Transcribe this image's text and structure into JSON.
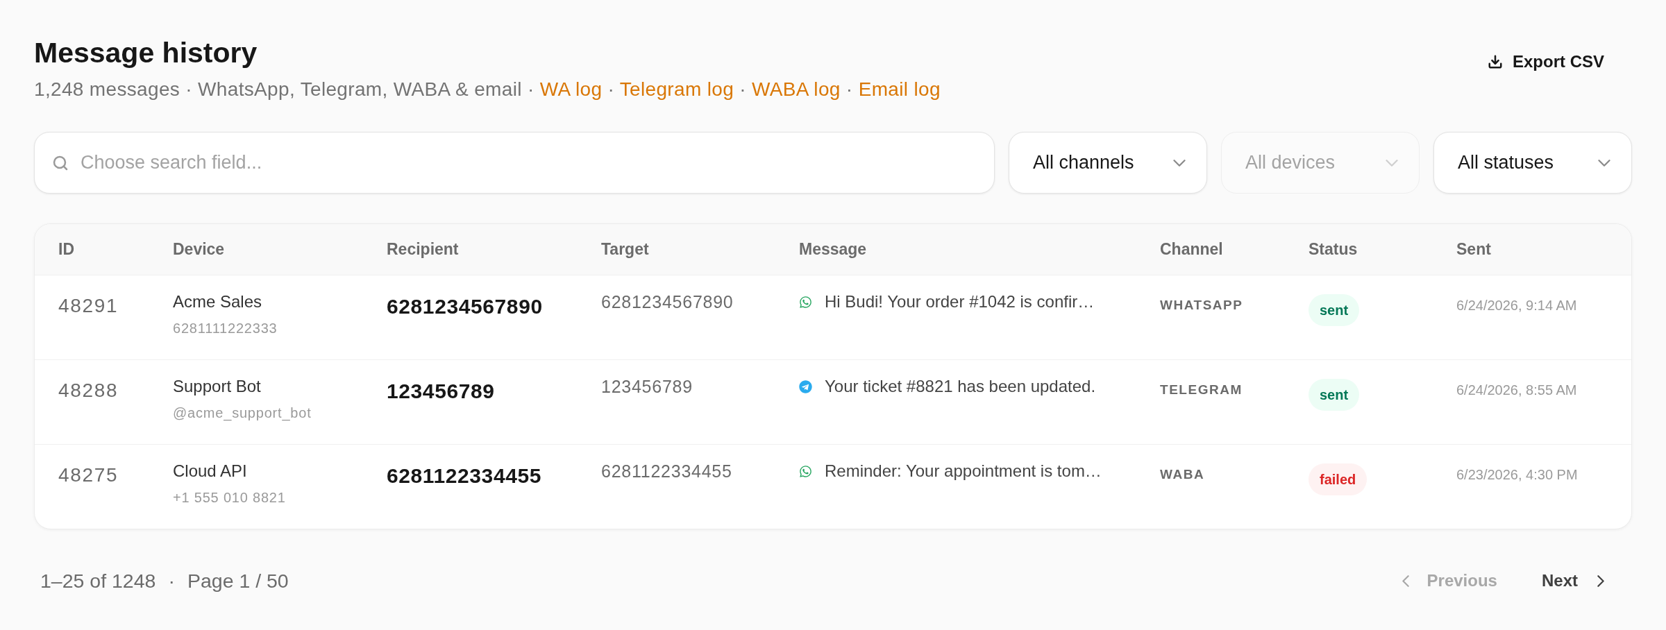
{
  "header": {
    "title": "Message history",
    "summary": "1,248 messages · WhatsApp, Telegram, WABA & email",
    "separator": "·",
    "links": [
      "WA log",
      "Telegram log",
      "WABA log",
      "Email log"
    ],
    "export_button": "Export CSV"
  },
  "filters": {
    "search": {
      "placeholder": "Choose search field..."
    },
    "selects": [
      {
        "value": "All channels",
        "disabled": false
      },
      {
        "value": "All devices",
        "disabled": true
      },
      {
        "value": "All statuses",
        "disabled": false
      }
    ]
  },
  "table": {
    "columns": [
      "ID",
      "Device",
      "Recipient",
      "Target",
      "Message",
      "Channel",
      "Status",
      "Sent"
    ],
    "rows": [
      {
        "id": "48291",
        "device": {
          "name": "Acme Sales",
          "detail": "6281111222333"
        },
        "recipient": "6281234567890",
        "target": "6281234567890",
        "message": {
          "kind": "whatsapp",
          "text": "Hi Budi! Your order #1042 is confir…"
        },
        "channel": "WHATSAPP",
        "status": {
          "label": "sent",
          "kind": "success"
        },
        "sent": "6/24/2026, 9:14 AM"
      },
      {
        "id": "48288",
        "device": {
          "name": "Support Bot",
          "detail": "@acme_support_bot"
        },
        "recipient": "123456789",
        "target": "123456789",
        "message": {
          "kind": "telegram",
          "text": "Your ticket #8821 has been updated."
        },
        "channel": "TELEGRAM",
        "status": {
          "label": "sent",
          "kind": "success"
        },
        "sent": "6/24/2026, 8:55 AM"
      },
      {
        "id": "48275",
        "device": {
          "name": "Cloud API",
          "detail": "+1 555 010 8821"
        },
        "recipient": "6281122334455",
        "target": "6281122334455",
        "message": {
          "kind": "whatsapp",
          "text": "Reminder: Your appointment is tom…"
        },
        "channel": "WABA",
        "status": {
          "label": "failed",
          "kind": "danger"
        },
        "sent": "6/23/2026, 4:30 PM"
      }
    ]
  },
  "pagination": {
    "range": "1–25 of 1248",
    "separator": "·",
    "page": "Page 1 / 50",
    "previous": {
      "label": "Previous",
      "disabled": true
    },
    "next": {
      "label": "Next",
      "disabled": false
    }
  }
}
